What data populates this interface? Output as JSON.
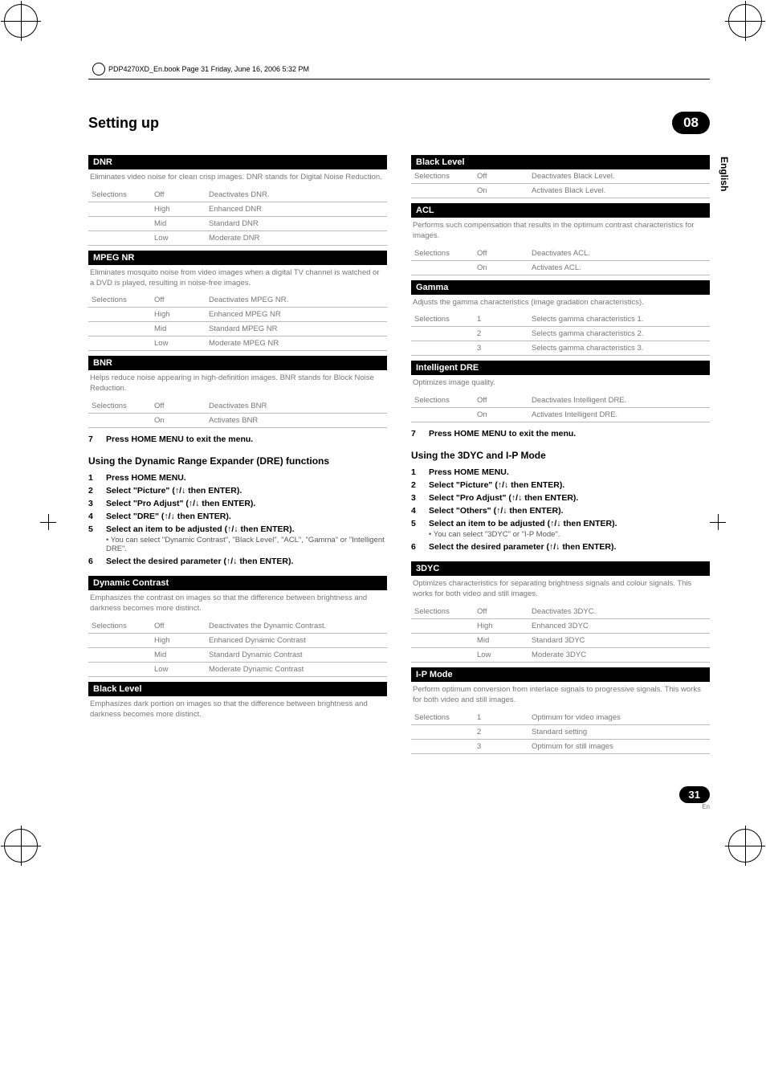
{
  "meta": {
    "book_line": "PDP4270XD_En.book  Page 31  Friday, June 16, 2006  5:32 PM"
  },
  "header": {
    "title": "Setting up",
    "badge": "08",
    "language_tab": "English"
  },
  "dnr": {
    "title": "DNR",
    "desc": "Eliminates video noise for clean crisp images. DNR stands for Digital Noise Reduction.",
    "rows": [
      [
        "Selections",
        "Off",
        "Deactivates DNR."
      ],
      [
        "",
        "High",
        "Enhanced DNR"
      ],
      [
        "",
        "Mid",
        "Standard DNR"
      ],
      [
        "",
        "Low",
        "Moderate DNR"
      ]
    ]
  },
  "mpegnr": {
    "title": "MPEG NR",
    "desc": "Eliminates mosquito noise from video images when a digital TV channel is watched or a DVD is played, resulting in noise-free images.",
    "rows": [
      [
        "Selections",
        "Off",
        "Deactivates MPEG NR."
      ],
      [
        "",
        "High",
        "Enhanced MPEG NR"
      ],
      [
        "",
        "Mid",
        "Standard MPEG NR"
      ],
      [
        "",
        "Low",
        "Moderate MPEG NR"
      ]
    ]
  },
  "bnr": {
    "title": "BNR",
    "desc": "Helps reduce noise appearing in high-definition images. BNR stands for Block Noise Reduction.",
    "rows": [
      [
        "Selections",
        "Off",
        "Deactivates BNR"
      ],
      [
        "",
        "On",
        "Activates BNR"
      ]
    ]
  },
  "exit_step_left": "Press HOME MENU to exit the menu.",
  "dre_section": {
    "heading": "Using the Dynamic Range Expander (DRE) functions",
    "steps": [
      {
        "n": "1",
        "t": "Press HOME MENU."
      },
      {
        "n": "2",
        "t": "Select \"Picture\" (↑/↓ then ENTER)."
      },
      {
        "n": "3",
        "t": "Select \"Pro Adjust\" (↑/↓ then ENTER)."
      },
      {
        "n": "4",
        "t": "Select \"DRE\" (↑/↓ then ENTER)."
      },
      {
        "n": "5",
        "t": "Select an item to be adjusted (↑/↓ then ENTER).",
        "sub": "• You can select \"Dynamic Contrast\", \"Black Level\", \"ACL\", \"Gamma\" or \"Intelligent DRE\"."
      },
      {
        "n": "6",
        "t": "Select the desired parameter (↑/↓ then ENTER)."
      }
    ]
  },
  "dyn_contrast": {
    "title": "Dynamic Contrast",
    "desc": "Emphasizes the contrast on images so that the difference between brightness and darkness becomes more distinct.",
    "rows": [
      [
        "Selections",
        "Off",
        "Deactivates the Dynamic Contrast."
      ],
      [
        "",
        "High",
        "Enhanced Dynamic Contrast"
      ],
      [
        "",
        "Mid",
        "Standard Dynamic Contrast"
      ],
      [
        "",
        "Low",
        "Moderate Dynamic Contrast"
      ]
    ]
  },
  "black_level_left": {
    "title": "Black Level",
    "desc": "Emphasizes dark portion on images so that the difference between brightness and darkness becomes more distinct."
  },
  "black_level_right": {
    "title": "Black Level",
    "rows": [
      [
        "Selections",
        "Off",
        "Deactivates Black Level."
      ],
      [
        "",
        "On",
        "Activates Black Level."
      ]
    ]
  },
  "acl": {
    "title": "ACL",
    "desc": "Performs such compensation that results in the optimum contrast characteristics for images.",
    "rows": [
      [
        "Selections",
        "Off",
        "Deactivates ACL."
      ],
      [
        "",
        "On",
        "Activates ACL."
      ]
    ]
  },
  "gamma": {
    "title": "Gamma",
    "desc": "Adjusts the gamma characteristics (image gradation characteristics).",
    "rows": [
      [
        "Selections",
        "1",
        "Selects gamma characteristics 1."
      ],
      [
        "",
        "2",
        "Selects gamma characteristics 2."
      ],
      [
        "",
        "3",
        "Selects gamma characteristics 3."
      ]
    ]
  },
  "idre": {
    "title": "Intelligent DRE",
    "desc": "Optimizes image quality.",
    "rows": [
      [
        "Selections",
        "Off",
        "Deactivates Intelligent DRE."
      ],
      [
        "",
        "On",
        "Activates Intelligent DRE."
      ]
    ]
  },
  "exit_step_right": "Press HOME MENU to exit the menu.",
  "ip_section": {
    "heading": "Using the 3DYC and I-P Mode",
    "steps": [
      {
        "n": "1",
        "t": "Press HOME MENU."
      },
      {
        "n": "2",
        "t": "Select \"Picture\" (↑/↓ then ENTER)."
      },
      {
        "n": "3",
        "t": "Select \"Pro Adjust\" (↑/↓ then ENTER)."
      },
      {
        "n": "4",
        "t": "Select \"Others\" (↑/↓ then ENTER)."
      },
      {
        "n": "5",
        "t": "Select an item to be adjusted (↑/↓ then ENTER).",
        "sub": "• You can select \"3DYC\" or \"I-P Mode\"."
      },
      {
        "n": "6",
        "t": "Select the desired parameter (↑/↓ then ENTER)."
      }
    ]
  },
  "tdyc": {
    "title": "3DYC",
    "desc": "Optimizes characteristics for separating brightness signals and colour signals. This works for both video and still images.",
    "rows": [
      [
        "Selections",
        "Off",
        "Deactivates 3DYC."
      ],
      [
        "",
        "High",
        "Enhanced 3DYC"
      ],
      [
        "",
        "Mid",
        "Standard 3DYC"
      ],
      [
        "",
        "Low",
        "Moderate 3DYC"
      ]
    ]
  },
  "ipmode": {
    "title": "I-P Mode",
    "desc": "Perform optimum conversion from interlace signals to progressive signals. This works for both video and still images.",
    "rows": [
      [
        "Selections",
        "1",
        "Optimum for video images"
      ],
      [
        "",
        "2",
        "Standard setting"
      ],
      [
        "",
        "3",
        "Optimum for still images"
      ]
    ]
  },
  "footer": {
    "page": "31",
    "lang": "En"
  }
}
